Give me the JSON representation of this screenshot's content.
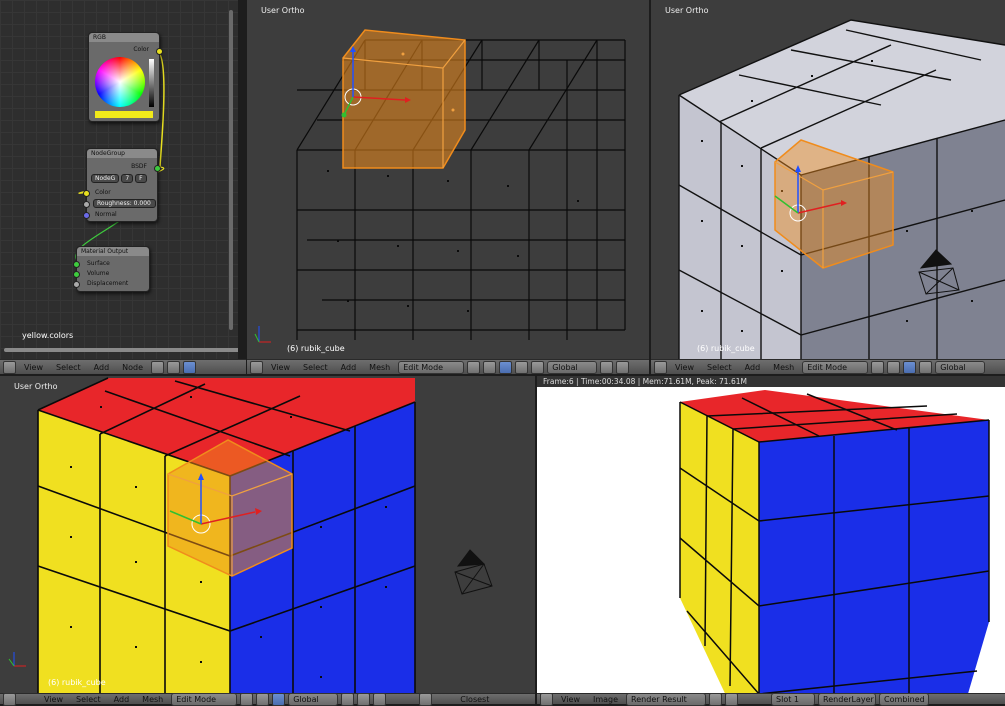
{
  "node_editor": {
    "nodes": {
      "rgb": {
        "title": "RGB",
        "output": "Color",
        "swatch": "#f2ea1a"
      },
      "group": {
        "title": "NodeGroup",
        "output": "BSDF",
        "selector": "NodeG",
        "users": "7",
        "fake": "F",
        "inputs": [
          "Color",
          "Roughness: 0.000",
          "Normal"
        ]
      },
      "output": {
        "title": "Material Output",
        "inputs": [
          "Surface",
          "Volume",
          "Displacement"
        ]
      }
    },
    "material_name": "yellow.colors",
    "header": {
      "menus": [
        "View",
        "Select",
        "Add",
        "Node"
      ]
    }
  },
  "vp_wire": {
    "label": "User Ortho",
    "object": "(6) rubik_cube",
    "header": {
      "menus": [
        "View",
        "Select",
        "Add",
        "Mesh"
      ],
      "mode": "Edit Mode",
      "orientation": "Global"
    }
  },
  "vp_solid": {
    "label": "User Ortho",
    "object": "(6) rubik_cube",
    "header": {
      "menus": [
        "View",
        "Select",
        "Add",
        "Mesh"
      ],
      "mode": "Edit Mode",
      "orientation": "Global"
    }
  },
  "vp_color": {
    "label": "User Ortho",
    "object": "(6) rubik_cube",
    "header": {
      "menus": [
        "View",
        "Select",
        "Add",
        "Mesh"
      ],
      "mode": "Edit Mode",
      "orientation": "Global",
      "snap": "Closest"
    }
  },
  "render": {
    "stats": "Frame:6 | Time:00:34.08 | Mem:71.61M, Peak: 71.61M",
    "header": {
      "menus": [
        "View",
        "Image"
      ],
      "image": "Render Result",
      "slot": "Slot 1",
      "layer": "RenderLayer",
      "pass": "Combined"
    }
  },
  "colors": {
    "red": "#e8262a",
    "yellow": "#f0e020",
    "blue": "#1a2ee8",
    "selection": "#f08c1c",
    "viewport": "#3d3d3d"
  }
}
